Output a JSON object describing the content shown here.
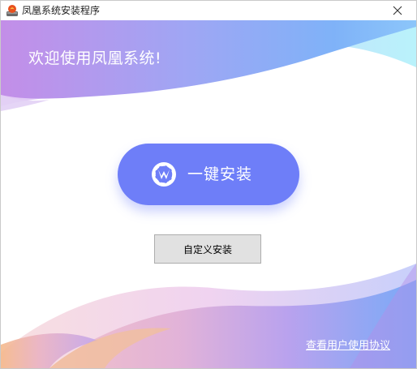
{
  "window": {
    "title": "凤凰系统安装程序",
    "close_glyph": "✕"
  },
  "main": {
    "welcome_text": "欢迎使用凤凰系统!",
    "install_button_label": "一键安装",
    "custom_install_label": "自定义安装",
    "agreement_link": "查看用户使用协议"
  },
  "colors": {
    "primary_button": "#6e7ef8",
    "secondary_button": "#e1e1e1"
  },
  "icons": {
    "app": "phoenix-app-icon",
    "install": "phoenix-logo-icon",
    "close": "close-icon"
  }
}
